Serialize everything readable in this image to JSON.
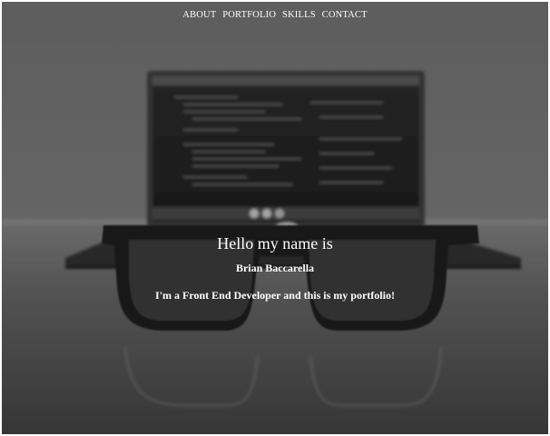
{
  "nav": {
    "items": [
      {
        "label": "ABOUT"
      },
      {
        "label": "PORTFOLIO"
      },
      {
        "label": "SKILLS"
      },
      {
        "label": "CONTACT"
      }
    ]
  },
  "hero": {
    "greeting": "Hello my name is",
    "name": "Brian Baccarella",
    "tagline": "I'm a Front End Developer and this is my portfolio!"
  }
}
